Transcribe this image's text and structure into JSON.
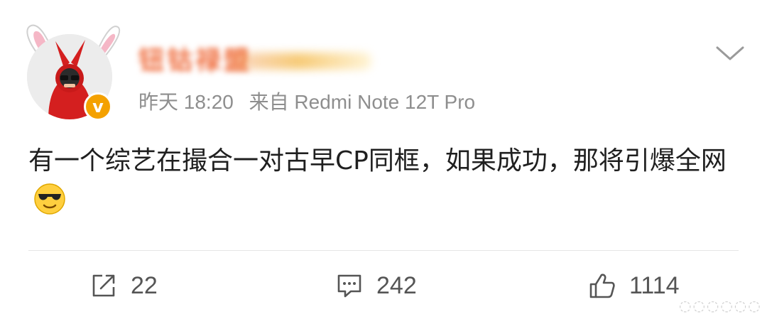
{
  "post": {
    "author_name": "钮钴禄盟",
    "time": "昨天 18:20",
    "source": "来自 Redmi Note 12T Pro",
    "text": "有一个综艺在撮合一对古早CP同框，如果成功，那将引爆全网",
    "verified_badge": "v"
  },
  "actions": {
    "repost_count": "22",
    "comment_count": "242",
    "like_count": "1114"
  },
  "icons": {
    "more": "chevron-down-icon",
    "repost": "share-icon",
    "comment": "comment-icon",
    "like": "thumbs-up-icon",
    "emoji": "sunglasses-face-icon"
  },
  "colors": {
    "username": "#ef6b3b",
    "meta": "#8e8e8e",
    "badge": "#f4a100"
  }
}
